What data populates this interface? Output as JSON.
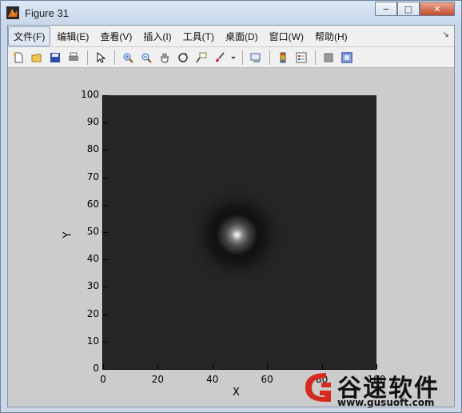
{
  "window": {
    "title": "Figure 31"
  },
  "title_buttons": {
    "minimize": "−",
    "maximize": "□",
    "close": "✕"
  },
  "menubar": {
    "items": [
      {
        "label": "文件(F)"
      },
      {
        "label": "编辑(E)"
      },
      {
        "label": "查看(V)"
      },
      {
        "label": "插入(I)"
      },
      {
        "label": "工具(T)"
      },
      {
        "label": "桌面(D)"
      },
      {
        "label": "窗口(W)"
      },
      {
        "label": "帮助(H)"
      }
    ],
    "overflow_icon": "↘"
  },
  "toolbar": {
    "buttons": [
      "new-figure-icon",
      "open-icon",
      "save-icon",
      "print-icon",
      "select-arrow-icon",
      "zoom-in-icon",
      "zoom-out-icon",
      "pan-hand-icon",
      "rotate-3d-icon",
      "data-cursor-icon",
      "brush-icon",
      "dropdown-arrow-icon",
      "link-plot-icon",
      "colorbar-icon",
      "legend-icon",
      "hide-plot-tools-icon",
      "show-plot-tools-icon"
    ]
  },
  "chart_data": {
    "type": "heatmap",
    "xlabel": "X",
    "ylabel": "Y",
    "xlim": [
      0,
      100
    ],
    "ylim": [
      0,
      100
    ],
    "x_ticks": [
      "0",
      "20",
      "40",
      "60",
      "80",
      "100"
    ],
    "y_ticks": [
      "0",
      "10",
      "20",
      "30",
      "40",
      "50",
      "60",
      "70",
      "80",
      "90",
      "100"
    ],
    "peak": {
      "x": 49,
      "y": 49
    },
    "colormap": "gray",
    "background_color": "#262626"
  },
  "watermark": {
    "title": "谷速软件",
    "url": "www.gusuoft.com"
  }
}
